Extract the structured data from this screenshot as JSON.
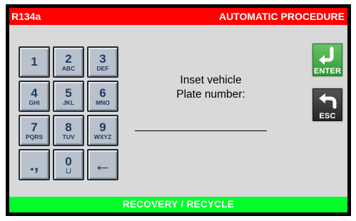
{
  "header": {
    "refrigerant": "R134a",
    "procedure": "AUTOMATIC PROCEDURE"
  },
  "keypad": {
    "keys": [
      {
        "digit": "1",
        "letters": ""
      },
      {
        "digit": "2",
        "letters": "ABC"
      },
      {
        "digit": "3",
        "letters": "DEF"
      },
      {
        "digit": "4",
        "letters": "GHI"
      },
      {
        "digit": "5",
        "letters": "JKL"
      },
      {
        "digit": "6",
        "letters": "MNO"
      },
      {
        "digit": "7",
        "letters": "PQRS"
      },
      {
        "digit": "8",
        "letters": "TUV"
      },
      {
        "digit": "9",
        "letters": "WXYZ"
      },
      {
        "digit": ".,",
        "letters": ""
      },
      {
        "digit": "0",
        "letters": "⊔"
      },
      {
        "digit": "←",
        "letters": ""
      }
    ]
  },
  "prompt": {
    "line1": "Inset vehicle",
    "line2": "Plate number:"
  },
  "entry": {
    "value": ""
  },
  "buttons": {
    "enter_label": "ENTER",
    "esc_label": "ESC"
  },
  "footer": {
    "mode": "RECOVERY / RECYCLE"
  },
  "colors": {
    "header_bg": "#ff0000",
    "footer_bg": "#00ff2a",
    "enter_bg": "#3fae45",
    "esc_bg": "#333333",
    "key_bg": "#b9c1cc"
  }
}
